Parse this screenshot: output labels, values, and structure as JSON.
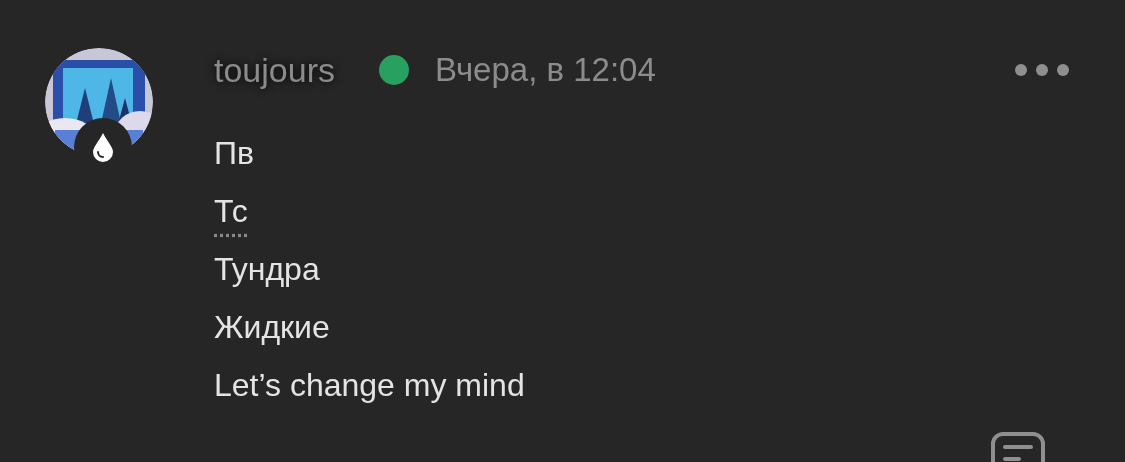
{
  "message": {
    "author": "toujours",
    "status": {
      "online": true,
      "color": "#27a060"
    },
    "time": "Вчера, в 12:04",
    "lines": [
      {
        "kind": "text",
        "text": "Пв"
      },
      {
        "kind": "abbr",
        "text": "Тс"
      },
      {
        "kind": "text",
        "text": "Тундра"
      },
      {
        "kind": "text",
        "text": "Жидкие"
      },
      {
        "kind": "text",
        "text": "Let’s change my mind"
      }
    ]
  }
}
